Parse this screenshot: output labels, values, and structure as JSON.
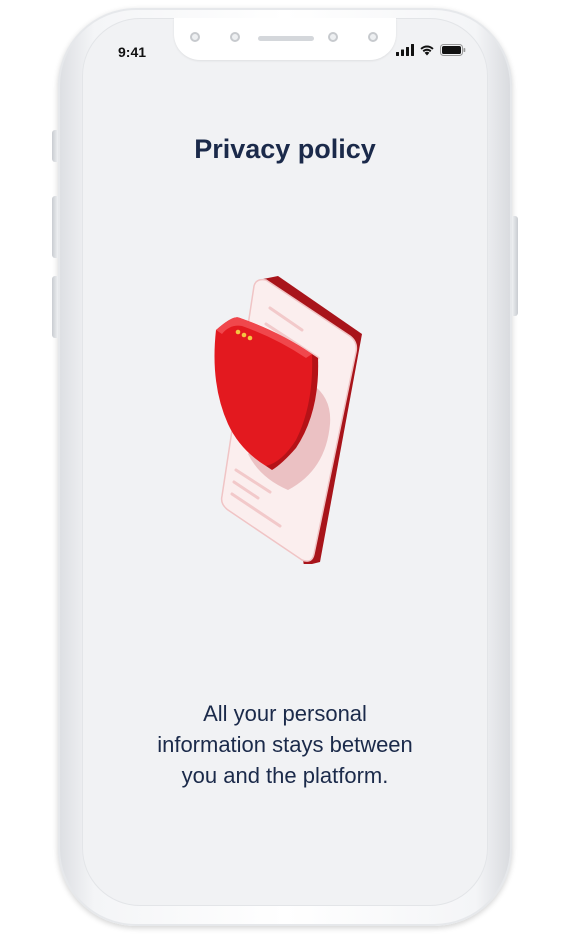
{
  "status_bar": {
    "time": "9:41",
    "icons": [
      "cellular-signal-icon",
      "wifi-icon",
      "battery-icon"
    ]
  },
  "page": {
    "title": "Privacy policy",
    "description_lines": [
      "All your personal",
      "information stays between",
      "you and the platform."
    ]
  },
  "illustration": {
    "name": "shield-phone-illustration",
    "colors": {
      "shield": "#e3191f",
      "shield_dark": "#b51217",
      "phone_edge": "#a8141a",
      "phone_face": "#fbeeee",
      "accent_dots": "#f5c542"
    }
  },
  "theme": {
    "background": "#f1f2f4",
    "text": "#1b2a4a"
  }
}
